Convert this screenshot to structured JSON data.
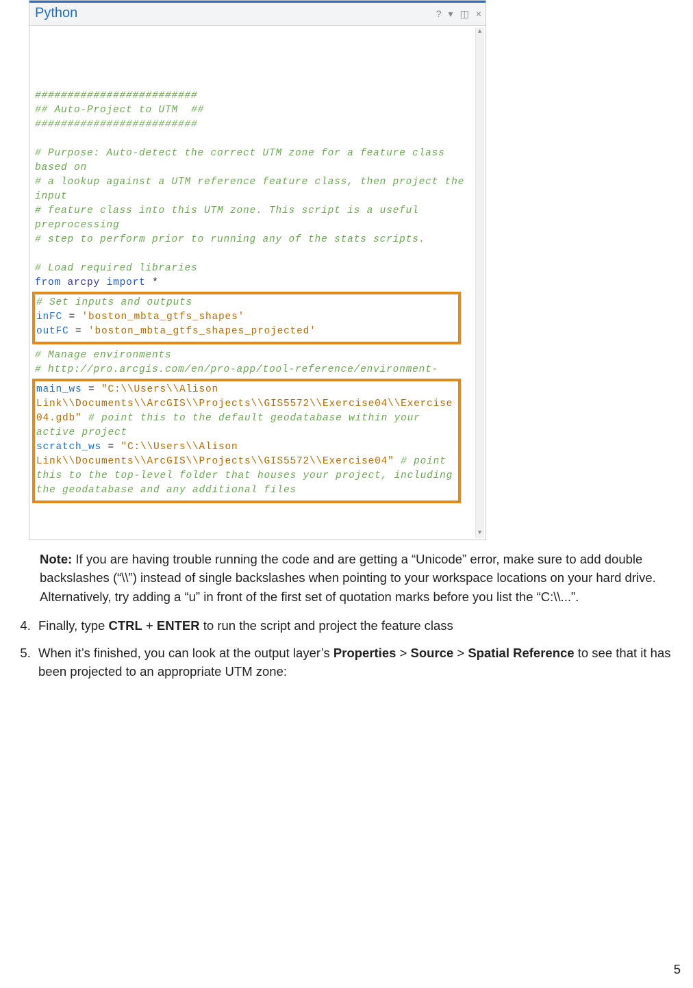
{
  "panel": {
    "title": "Python",
    "controls": {
      "help": "?",
      "menu": "▾",
      "pin": "◫",
      "close": "×"
    }
  },
  "code": {
    "hash1": "#########################",
    "hash2": "## Auto-Project to UTM  ##",
    "hash3": "#########################",
    "purpose1": "# Purpose: Auto-detect the correct UTM zone for a feature class based on",
    "purpose2": "# a lookup against a UTM reference feature class, then project the input",
    "purpose3": "# feature class into this UTM zone. This script is a useful preprocessing",
    "purpose4": "# step to perform prior to running any of the stats scripts.",
    "loadlib": "# Load required libraries",
    "from": "from",
    "arcpy": "arcpy",
    "import": "import",
    "star": "*",
    "setio": "# Set inputs and outputs",
    "inFC": "inFC",
    "inFCval": "'boston_mbta_gtfs_shapes'",
    "outFC": "outFC",
    "outFCval": "'boston_mbta_gtfs_shapes_projected'",
    "eq": " = ",
    "manage": "# Manage environments",
    "envurl": "# http://pro.arcgis.com/en/pro-app/tool-reference/environment-",
    "mainws": "main_ws",
    "mainwsval1": "\"C:\\\\Users\\\\Alison Link\\\\Documents\\\\ArcGIS\\\\Projects\\\\GIS5572\\\\Exercise04\\\\Exercise04.gdb\"",
    "mainwscmt": " # point this to the default geodatabase within your active project",
    "scratchws": "scratch_ws",
    "scratchwsval": "\"C:\\\\Users\\\\Alison Link\\\\Documents\\\\ArcGIS\\\\Projects\\\\GIS5572\\\\Exercise04\"",
    "scratchwscmt": " # point this to the top-level folder that houses your project, including the geodatabase and any additional files"
  },
  "note": {
    "label": "Note:",
    "text": " If you are having trouble running the code and are getting a “Unicode” error, make sure to add double backslashes (“\\\\”) instead of single backslashes when pointing to your workspace locations on your hard drive.  Alternatively, try adding a “u” in front of the first set of quotation marks before you list the “C:\\\\...”."
  },
  "steps": {
    "s4a": "Finally, type ",
    "s4b": "CTRL",
    "s4c": " + ",
    "s4d": "ENTER",
    "s4e": " to run the script and project the feature class",
    "s5a": "When it’s finished, you can look at the output layer’s ",
    "s5b": "Properties",
    "s5c": " > ",
    "s5d": "Source",
    "s5e": " > ",
    "s5f": "Spatial Reference",
    "s5g": " to see that it has been projected to an appropriate UTM zone:"
  },
  "pagenum": "5"
}
